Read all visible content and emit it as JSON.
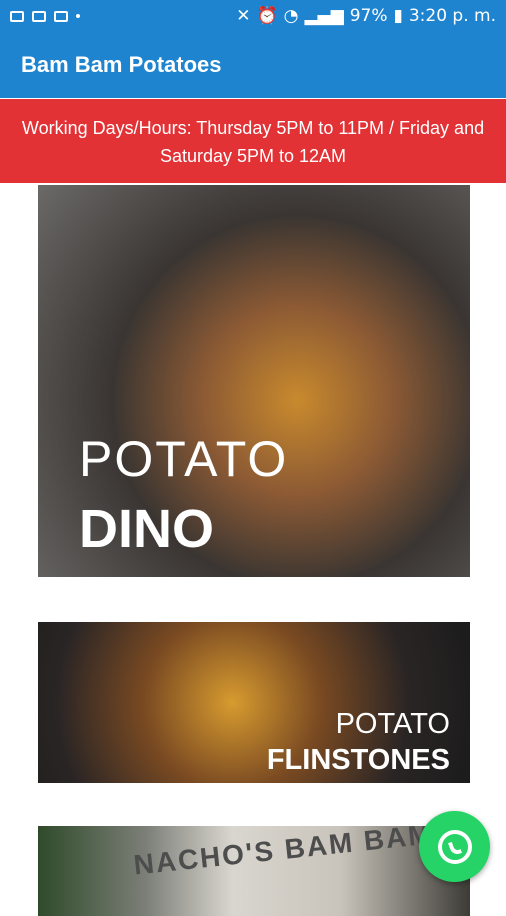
{
  "status_bar": {
    "battery": "97%",
    "time": "3:20 p. m."
  },
  "app_bar": {
    "title": "Bam Bam Potatoes"
  },
  "banner": {
    "text": "Working Days/Hours: Thursday 5PM to 11PM / Friday and Saturday 5PM to 12AM"
  },
  "menu": {
    "items": [
      {
        "line1": "POTATO",
        "line2": "DINO"
      },
      {
        "line1": "POTATO",
        "line2": "FLINSTONES"
      },
      {
        "sign": "NACHO'S BAM BAM"
      }
    ]
  },
  "fab": {
    "icon": "whatsapp-icon"
  }
}
